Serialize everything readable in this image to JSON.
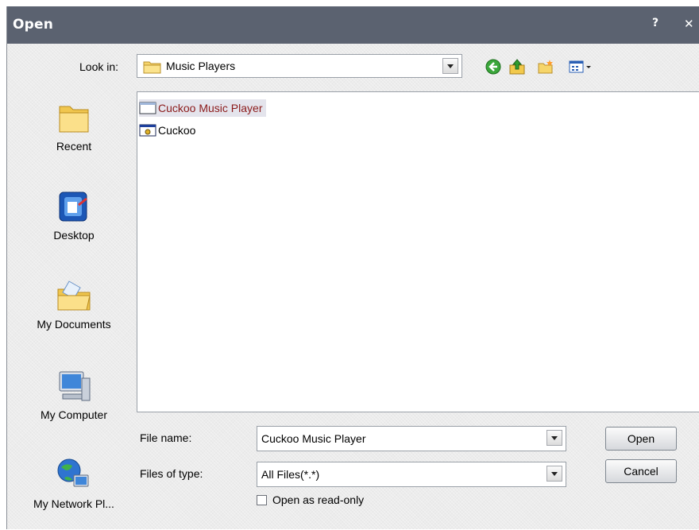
{
  "window": {
    "title": "Open",
    "help_label": "?",
    "close_label": "✕"
  },
  "toolbar": {
    "look_in_label": "Look in:",
    "look_in_value": "Music Players",
    "look_in_icon": "folder-icon",
    "buttons": [
      "back-icon",
      "up-folder-icon",
      "new-folder-icon",
      "views-menu-icon"
    ]
  },
  "places": [
    {
      "label": "Recent",
      "icon": "recent-folder-icon"
    },
    {
      "label": "Desktop",
      "icon": "desktop-icon"
    },
    {
      "label": "My Documents",
      "icon": "my-documents-icon"
    },
    {
      "label": "My Computer",
      "icon": "my-computer-icon"
    },
    {
      "label": "My Network Pl...",
      "icon": "network-icon"
    }
  ],
  "files": [
    {
      "name": "Cuckoo Music Player",
      "icon": "application-window-icon",
      "selected": true
    },
    {
      "name": "Cuckoo",
      "icon": "application-exe-icon",
      "selected": false
    }
  ],
  "file_name": {
    "label": "File name:",
    "value": "Cuckoo Music Player"
  },
  "file_type": {
    "label": "Files of type:",
    "value": "All Files(*.*)"
  },
  "read_only": {
    "label": "Open as read-only",
    "checked": false
  },
  "buttons": {
    "open": "Open",
    "cancel": "Cancel"
  },
  "colors": {
    "titlebar": "#5b6270",
    "selected_text": "#8b1a1a",
    "dialog_bg": "#ececec"
  }
}
